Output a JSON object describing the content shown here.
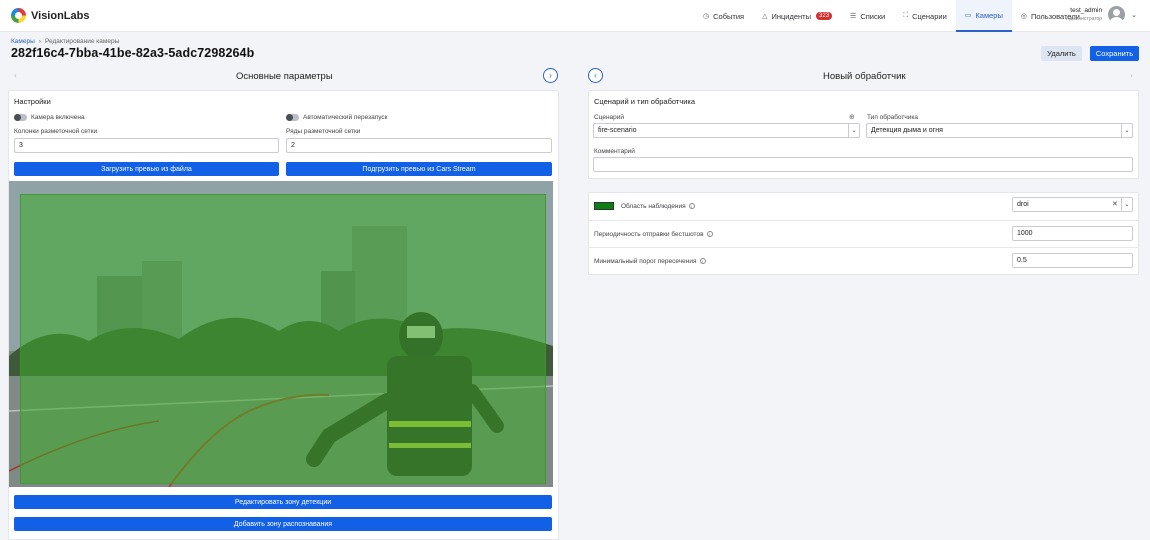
{
  "app": {
    "brand": "VisionLabs"
  },
  "nav": {
    "items": [
      {
        "label": "События",
        "icon": "clock-icon"
      },
      {
        "label": "Инциденты",
        "icon": "alert-triangle-icon",
        "badge": "323"
      },
      {
        "label": "Списки",
        "icon": "list-icon"
      },
      {
        "label": "Сценарии",
        "icon": "scenario-icon"
      },
      {
        "label": "Камеры",
        "icon": "camera-icon",
        "active": true
      },
      {
        "label": "Пользователи",
        "icon": "users-icon"
      }
    ]
  },
  "user": {
    "name": "test_admin",
    "role": "Администратор"
  },
  "breadcrumb": {
    "root": "Камеры",
    "separator": "›",
    "current": "Редактирование камеры"
  },
  "page": {
    "title": "282f16c4-7bba-41be-82a3-5adc7298264b"
  },
  "actions": {
    "delete_label": "Удалить",
    "save_label": "Сохранить"
  },
  "left": {
    "section_title": "Основные параметры",
    "card_title": "Настройки",
    "toggle_camera_label": "Камера включена",
    "toggle_restart_label": "Автоматический перезапуск",
    "grid_cols_label": "Колонки разметочной сетки",
    "grid_cols_value": "3",
    "grid_rows_label": "Ряды разметочной сетки",
    "grid_rows_value": "2",
    "upload_preview_label": "Загрузить превью из файла",
    "stream_preview_label": "Подгрузить превью из Cars Stream",
    "edit_zone_label": "Редактировать зону детекции",
    "add_zone_label": "Добавить зону распознавания"
  },
  "right": {
    "section_title": "Новый обработчик",
    "card_title": "Сценарий и тип обработчика",
    "scenario_label": "Сценарий",
    "scenario_value": "fire-scenario",
    "handler_type_label": "Тип обработчика",
    "handler_type_value": "Детекция дыма и огня",
    "comment_label": "Комментарий",
    "comment_value": "",
    "roi_label": "Область наблюдения",
    "roi_value": "droi",
    "bestshot_label": "Периодичность отправки бестшотов",
    "bestshot_value": "1000",
    "threshold_label": "Минимальный порог пересечения",
    "threshold_value": "0.5"
  },
  "colors": {
    "accent": "#1160e6",
    "zone_fill": "#3caa28",
    "roi_swatch": "#0b7f11",
    "badge": "#d32f2f"
  }
}
